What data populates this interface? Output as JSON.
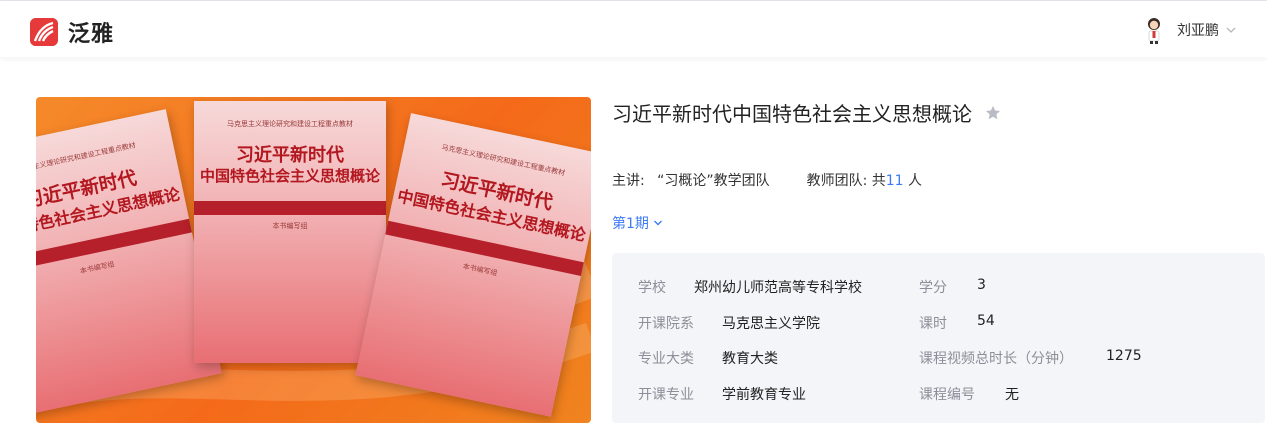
{
  "app": {
    "name": "泛雅",
    "brand_color": "#e63a3a",
    "accent_color": "#3d7bf5"
  },
  "user": {
    "name": "刘亚鹏",
    "avatar_icon": "user-avatar-icon"
  },
  "cover": {
    "books": [
      {
        "series": "马克思主义理论研究和建设工程重点教材",
        "line1": "习近平新时代",
        "line2": "中国特色社会主义思想概论",
        "editor": "本书编写组"
      },
      {
        "series": "马克思主义理论研究和建设工程重点教材",
        "line1": "习近平新时代",
        "line2": "中国特色社会主义思想概论",
        "editor": "本书编写组"
      },
      {
        "series": "马克思主义理论研究和建设工程重点教材",
        "line1": "习近平新时代",
        "line2": "中国特色社会主义思想概论",
        "editor": "本书编写组"
      }
    ]
  },
  "course": {
    "title": "习近平新时代中国特色社会主义思想概论",
    "lecturer_label": "主讲:",
    "lecturer": "“习概论”教学团队",
    "team_label": "教师团队: 共",
    "team_count": "11",
    "team_unit": "人",
    "term": "第1期"
  },
  "info": {
    "school_label": "学校",
    "school": "郑州幼儿师范高等专科学校",
    "credit_label": "学分",
    "credit": "3",
    "dept_label": "开课院系",
    "dept": "马克思主义学院",
    "hours_label": "课时",
    "hours": "54",
    "category_label": "专业大类",
    "category": "教育大类",
    "video_label": "课程视频总时长（分钟）",
    "video": "1275",
    "major_label": "开课专业",
    "major": "学前教育专业",
    "code_label": "课程编号",
    "code": "无"
  }
}
